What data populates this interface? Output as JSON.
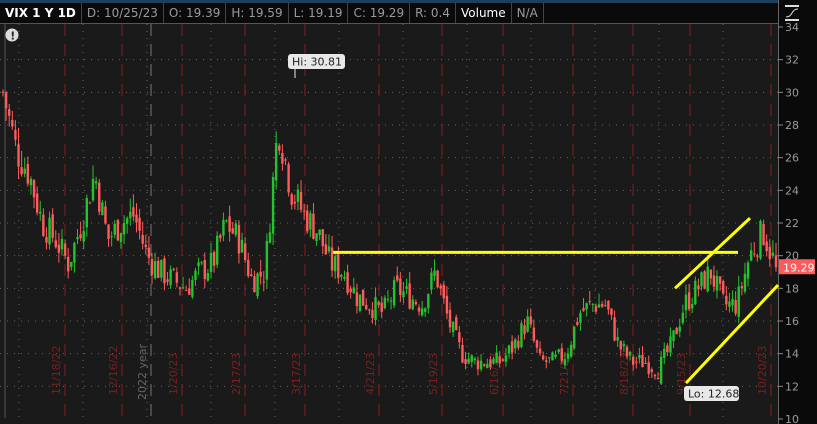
{
  "header": {
    "symbol": "VIX 1 Y 1D",
    "date": "D: 10/25/23",
    "open": "O: 19.39",
    "high": "H: 19.59",
    "low": "L: 19.19",
    "close": "C: 19.29",
    "range": "R: 0.4",
    "volume": "Volume",
    "volume_value": "N/A"
  },
  "colors": {
    "up": "#22c32e",
    "down": "#ff5b5b",
    "trendline": "#ffff00",
    "month_line": "#8b1a1a"
  },
  "chart_data": {
    "type": "candlestick",
    "title": "VIX 1 Y 1D",
    "ylim": [
      10,
      34
    ],
    "yticks": [
      10,
      12,
      14,
      16,
      18,
      20,
      22,
      24,
      26,
      28,
      30,
      32,
      34
    ],
    "date_labels": [
      "11/18/22",
      "12/16/22",
      "2022 year",
      "1/20/23",
      "2/17/23",
      "3/17/23",
      "4/21/23",
      "5/19/23",
      "6/16/23",
      "7/21/23",
      "8/18/23",
      "9/15/23",
      "10/20/23"
    ],
    "approx_close_path": [
      30,
      26.5,
      25,
      22,
      21,
      19.5,
      22,
      25,
      21,
      22,
      22.5,
      20,
      19,
      18.5,
      18,
      19,
      19.5,
      22,
      21,
      18.5,
      19,
      28,
      24,
      22.5,
      21.5,
      19.5,
      19,
      17.5,
      17,
      16.5,
      18,
      17.5,
      17,
      19,
      16,
      14,
      13.5,
      13.5,
      13.5,
      14.5,
      16,
      13.5,
      13.5,
      14,
      16.5,
      17,
      17,
      14.5,
      13.5,
      13.5,
      13,
      14.5,
      17,
      18,
      19,
      17,
      17,
      20,
      21.5,
      19.29
    ],
    "high": "Hi: 30.81",
    "low": "Lo: 12.68",
    "last_price": "19.29",
    "trendlines": [
      {
        "type": "horizontal",
        "value": 20.2
      },
      {
        "type": "channel-upper",
        "from": 18.0,
        "to": 22.3
      },
      {
        "type": "channel-lower",
        "from": 12.2,
        "to": 18.2
      }
    ]
  }
}
